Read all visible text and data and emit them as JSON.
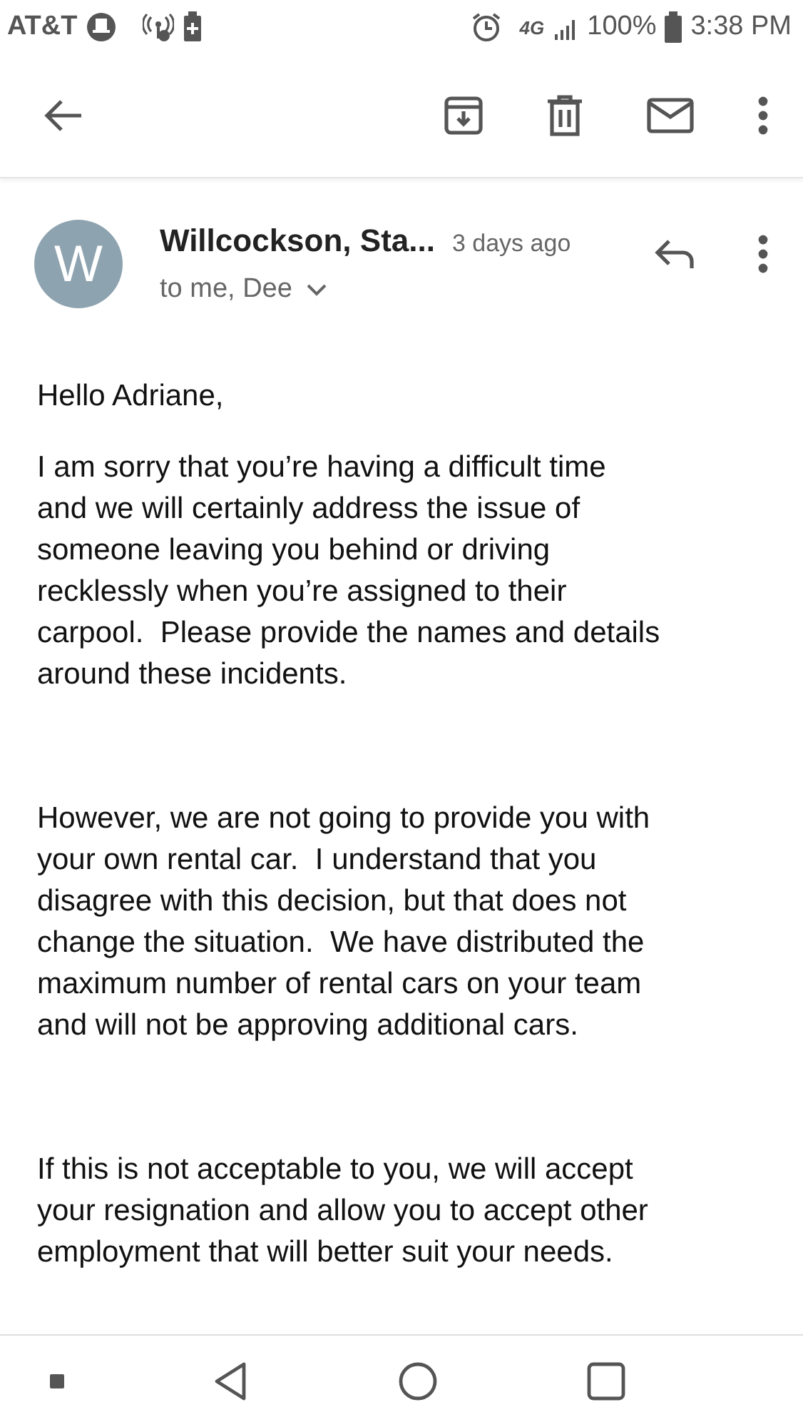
{
  "status_bar": {
    "carrier": "AT&T",
    "network": "4G",
    "battery": "100%",
    "time": "3:38 PM"
  },
  "message": {
    "avatar_letter": "W",
    "sender": "Willcockson, Sta...",
    "time": "3 days ago",
    "recipients": "to me, Dee",
    "body": [
      "Hello Adriane,",
      "I am sorry that you’re having a difficult time\nand we will certainly address the issue of\nsomeone leaving you behind or driving\nrecklessly when you’re assigned to their\ncarpool.  Please provide the names and details\naround these incidents.",
      "However, we are not going to provide you with\nyour own rental car.  I understand that you\ndisagree with this decision, but that does not\nchange the situation.  We have distributed the\nmaximum number of rental cars on your team\nand will not be approving additional cars.",
      "If this is not acceptable to you, we will accept\nyour resignation and allow you to accept other\nemployment that will better suit your needs."
    ]
  }
}
